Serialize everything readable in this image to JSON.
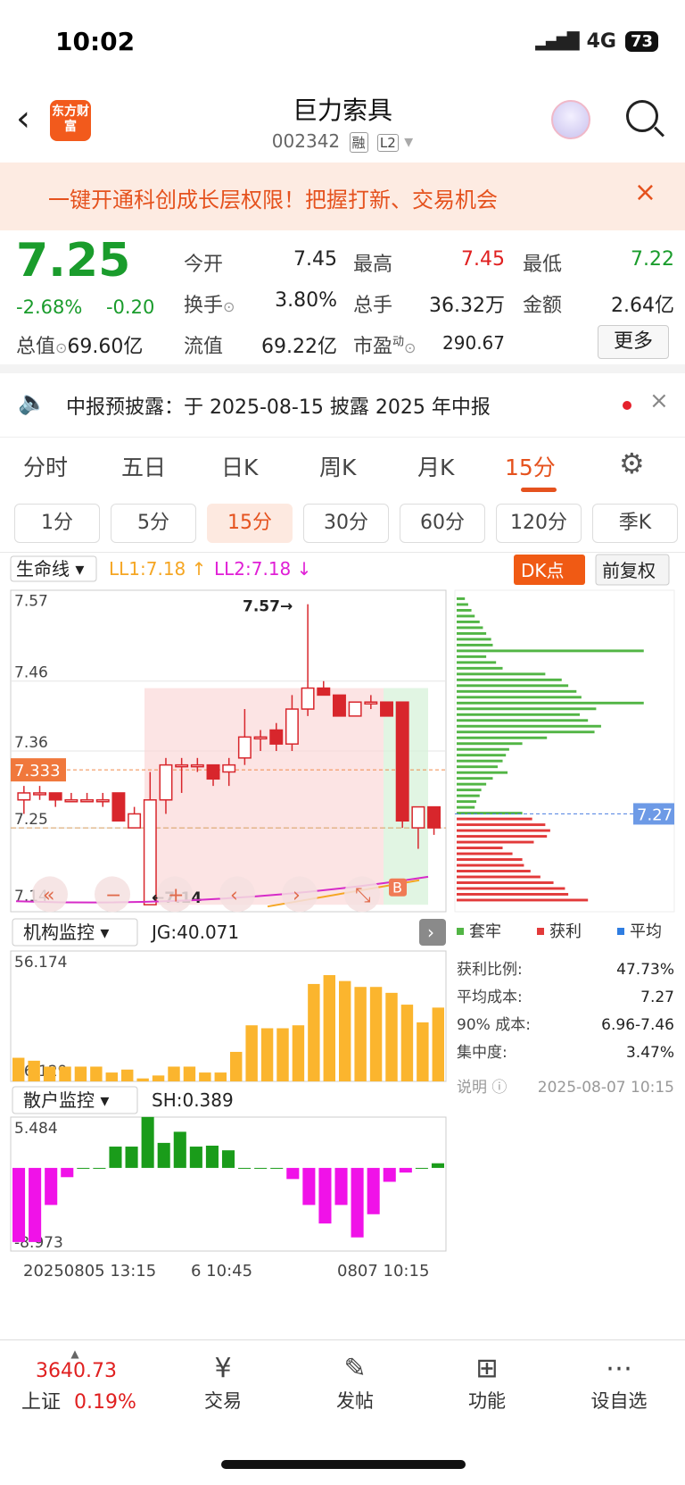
{
  "status": {
    "time": "10:02",
    "network": "4G",
    "battery": "73"
  },
  "header": {
    "logo": "东方财富",
    "title": "巨力索具",
    "code": "002342",
    "tags": [
      "融",
      "L2"
    ]
  },
  "banner": {
    "text": "一键开通科创成长层权限！把握打新、交易机会",
    "close": "×"
  },
  "quote": {
    "price": "7.25",
    "change_pct": "-2.68%",
    "change": "-0.20",
    "open_label": "今开",
    "open": "7.45",
    "high_label": "最高",
    "high": "7.45",
    "low_label": "最低",
    "low": "7.22",
    "turnover_label": "换手",
    "turnover": "3.80%",
    "volume_label": "总手",
    "volume": "36.32万",
    "amount_label": "金额",
    "amount": "2.64亿",
    "mcap_label": "总值",
    "mcap": "69.60亿",
    "float_label": "流值",
    "float": "69.22亿",
    "pe_label": "市盈",
    "pe_sup": "动",
    "pe": "290.67",
    "more": "更多"
  },
  "notice": {
    "text": "中报预披露：于 2025-08-15 披露 2025 年中报"
  },
  "period_tabs": [
    "分时",
    "五日",
    "日K",
    "周K",
    "月K",
    "15分"
  ],
  "minute_tabs": [
    "1分",
    "5分",
    "15分",
    "30分",
    "60分",
    "120分",
    "季K"
  ],
  "active_period": "15分",
  "chart_data": {
    "type": "candlestick",
    "indicator": "生命线",
    "ll1": "LL1:7.18",
    "ll2": "LL2:7.18",
    "dk_button": "DK点",
    "adjust_button": "前复权",
    "y_ticks": [
      "7.57",
      "7.46",
      "7.36",
      "7.25",
      "7.14"
    ],
    "current_marker": "7.333",
    "max_label": "7.57",
    "min_label": "7.14",
    "candles": [
      {
        "o": 7.29,
        "c": 7.3,
        "h": 7.31,
        "l": 7.27
      },
      {
        "o": 7.3,
        "c": 7.3,
        "h": 7.31,
        "l": 7.29
      },
      {
        "o": 7.3,
        "c": 7.29,
        "h": 7.3,
        "l": 7.28
      },
      {
        "o": 7.29,
        "c": 7.29,
        "h": 7.3,
        "l": 7.29
      },
      {
        "o": 7.29,
        "c": 7.29,
        "h": 7.3,
        "l": 7.29
      },
      {
        "o": 7.29,
        "c": 7.29,
        "h": 7.3,
        "l": 7.28
      },
      {
        "o": 7.3,
        "c": 7.26,
        "h": 7.3,
        "l": 7.26
      },
      {
        "o": 7.25,
        "c": 7.27,
        "h": 7.28,
        "l": 7.25
      },
      {
        "o": 7.14,
        "c": 7.29,
        "h": 7.33,
        "l": 7.14
      },
      {
        "o": 7.29,
        "c": 7.34,
        "h": 7.35,
        "l": 7.27
      },
      {
        "o": 7.34,
        "c": 7.34,
        "h": 7.35,
        "l": 7.3
      },
      {
        "o": 7.34,
        "c": 7.34,
        "h": 7.35,
        "l": 7.33
      },
      {
        "o": 7.34,
        "c": 7.32,
        "h": 7.34,
        "l": 7.31
      },
      {
        "o": 7.33,
        "c": 7.34,
        "h": 7.35,
        "l": 7.31
      },
      {
        "o": 7.35,
        "c": 7.38,
        "h": 7.42,
        "l": 7.34
      },
      {
        "o": 7.38,
        "c": 7.38,
        "h": 7.39,
        "l": 7.36
      },
      {
        "o": 7.39,
        "c": 7.37,
        "h": 7.4,
        "l": 7.36
      },
      {
        "o": 7.37,
        "c": 7.42,
        "h": 7.44,
        "l": 7.36
      },
      {
        "o": 7.42,
        "c": 7.45,
        "h": 7.57,
        "l": 7.41
      },
      {
        "o": 7.45,
        "c": 7.44,
        "h": 7.46,
        "l": 7.44
      },
      {
        "o": 7.44,
        "c": 7.41,
        "h": 7.44,
        "l": 7.41
      },
      {
        "o": 7.41,
        "c": 7.43,
        "h": 7.43,
        "l": 7.41
      },
      {
        "o": 7.43,
        "c": 7.43,
        "h": 7.44,
        "l": 7.42
      },
      {
        "o": 7.43,
        "c": 7.41,
        "h": 7.43,
        "l": 7.41
      },
      {
        "o": 7.43,
        "c": 7.26,
        "h": 7.43,
        "l": 7.25
      },
      {
        "o": 7.25,
        "c": 7.28,
        "h": 7.28,
        "l": 7.22
      },
      {
        "o": 7.28,
        "c": 7.25,
        "h": 7.28,
        "l": 7.24
      }
    ],
    "cost_marker": "7.27",
    "legend": [
      "套牢",
      "获利",
      "平均"
    ],
    "stats": [
      [
        "获利比例:",
        "47.73%"
      ],
      [
        "平均成本:",
        "7.27"
      ],
      [
        "90% 成本:",
        "6.96-7.46"
      ],
      [
        "集中度:",
        "3.47%"
      ]
    ],
    "note": "说明",
    "note_date": "2025-08-07 10:15",
    "jg_label": "机构监控",
    "jg_value": "JG:40.071",
    "jg_max": "56.174",
    "jg_min": "16.129",
    "jg_values": [
      20,
      19,
      17,
      17,
      17,
      17,
      15,
      16,
      13,
      14,
      17,
      17,
      15,
      15,
      22,
      31,
      30,
      30,
      31,
      45,
      48,
      46,
      44,
      44,
      42,
      38,
      32,
      37
    ],
    "sh_label": "散户监控",
    "sh_value": "SH:0.389",
    "sh_max": "5.484",
    "sh_min": "8.973",
    "sh_values": [
      -8,
      -8,
      -4,
      -1,
      0,
      0,
      2.3,
      2.3,
      5.5,
      2.7,
      3.9,
      2.3,
      2.4,
      1.9,
      0,
      0,
      0,
      -1.2,
      -4,
      -6,
      -4,
      -7.5,
      -5,
      -1.5,
      -0.5,
      0,
      0.5
    ],
    "x_labels": [
      "20250805 13:15",
      "6 10:45",
      "0807 10:15"
    ]
  },
  "footer": {
    "index_value": "3640.73",
    "index_name": "上证",
    "index_chg": "0.19%",
    "items": [
      "交易",
      "发帖",
      "功能",
      "设自选"
    ]
  }
}
